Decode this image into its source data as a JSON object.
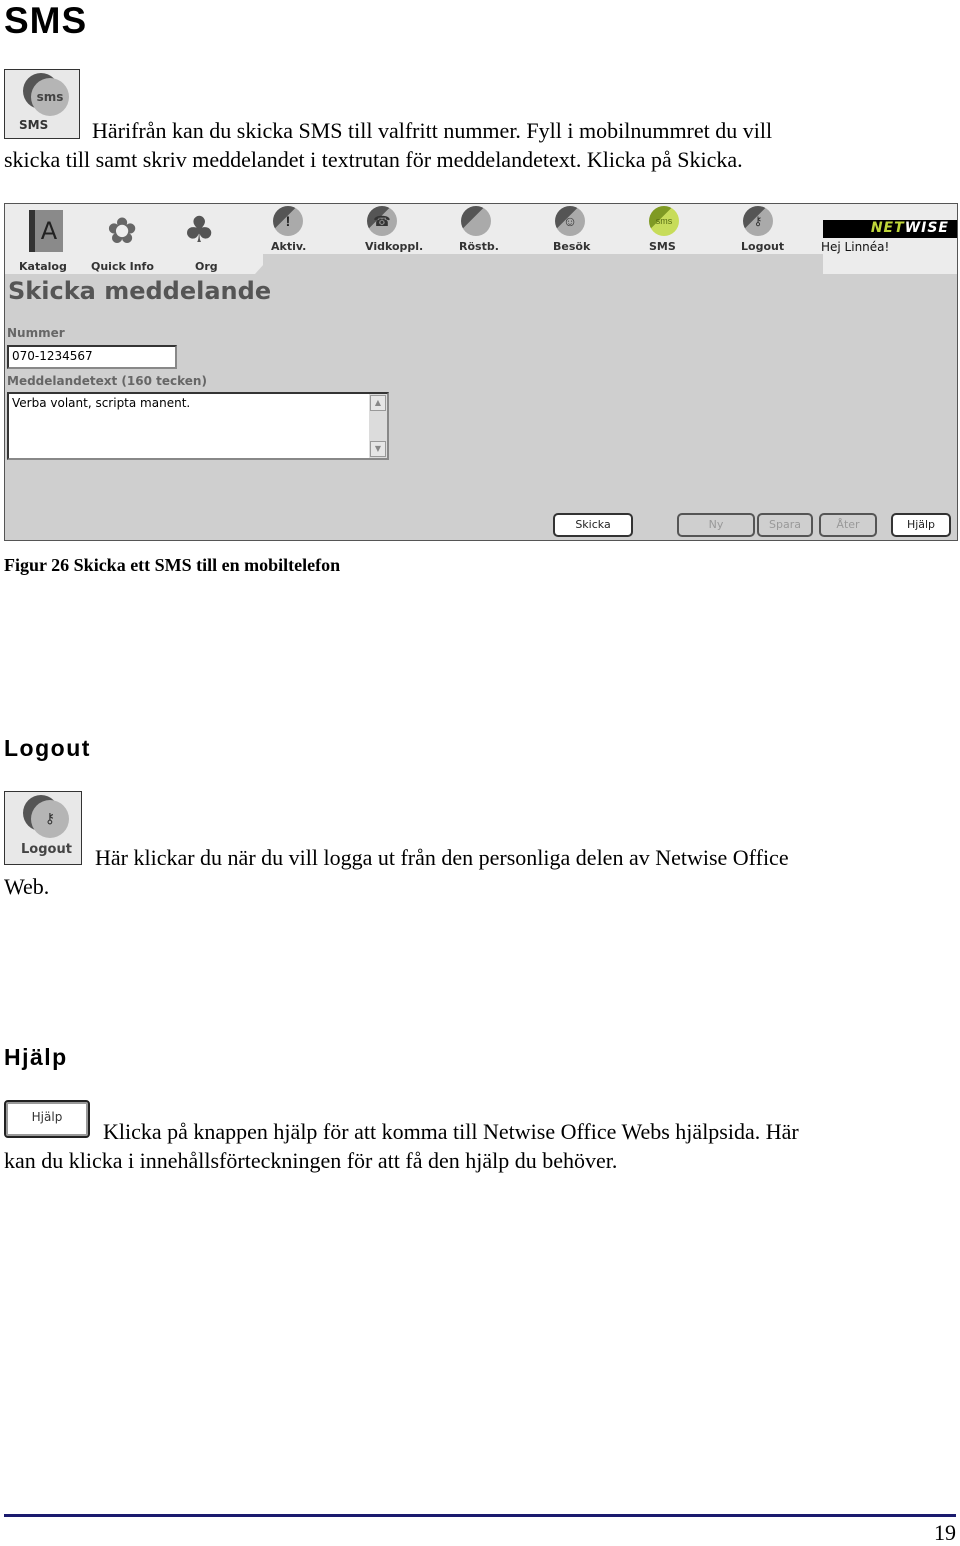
{
  "sections": {
    "sms": {
      "heading": "SMS",
      "icon_label": "SMS",
      "icon_badge": "sms",
      "paragraph_line1": "Härifrån kan du skicka SMS till valfritt nummer. Fyll i mobilnummret du vill",
      "paragraph_line2": "skicka till samt skriv meddelandet i textrutan för meddelandetext. Klicka på Skicka."
    },
    "logout": {
      "heading": "Logout",
      "icon_label": "Logout",
      "paragraph_line1": "Här klickar du när du vill logga ut från den personliga delen av Netwise Office",
      "paragraph_line2": "Web."
    },
    "help": {
      "heading": "Hjälp",
      "icon_label": "Hjälp",
      "paragraph_line1": "Klicka på knappen hjälp för att komma till Netwise Office Webs hjälpsida. Här",
      "paragraph_line2": "kan du klicka i innehållsförteckningen för att få den hjälp du behöver."
    }
  },
  "screenshot": {
    "toolbar": [
      {
        "label": "Katalog",
        "icon": "book-icon"
      },
      {
        "label": "Quick Info",
        "icon": "flower-icon"
      },
      {
        "label": "Org",
        "icon": "tree-icon"
      },
      {
        "label": "Aktiv.",
        "icon": "clock-alert-icon"
      },
      {
        "label": "Vidkoppl.",
        "icon": "phone-forward-icon"
      },
      {
        "label": "Röstb.",
        "icon": "voicemail-icon"
      },
      {
        "label": "Besök",
        "icon": "visitor-face-icon"
      },
      {
        "label": "SMS",
        "icon": "sms-icon"
      },
      {
        "label": "Logout",
        "icon": "key-icon"
      }
    ],
    "brand_net": "NET",
    "brand_wise": "WISE",
    "greeting": "Hej Linnéa!",
    "page_title": "Skicka meddelande",
    "number_label": "Nummer",
    "number_value": "070-1234567",
    "message_label": "Meddelandetext (160 tecken)",
    "message_value": "Verba volant, scripta manent.",
    "buttons": {
      "send": "Skicka",
      "new": "Ny",
      "save": "Spara",
      "back": "Åter",
      "help": "Hjälp"
    },
    "colors": {
      "active_sms": "#a6c23a",
      "brand_bg": "#000000",
      "brand_accent": "#bfd73a"
    }
  },
  "figure_caption": "Figur 26  Skicka ett SMS till en mobiltelefon",
  "page_number": "19"
}
